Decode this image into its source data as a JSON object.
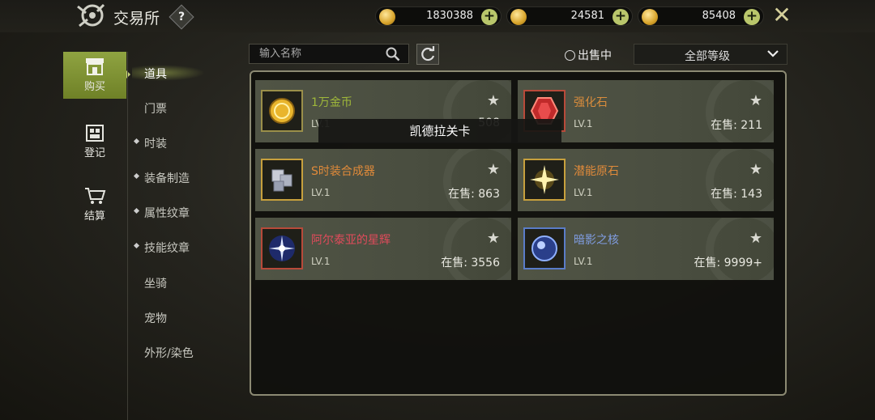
{
  "header": {
    "title": "交易所",
    "help": "?",
    "currencies": [
      {
        "name": "refresh-coin-icon",
        "value": "1830388",
        "color": "#d7a32a"
      },
      {
        "name": "gold-pile-icon",
        "value": "24581",
        "color": "#e2b33b"
      },
      {
        "name": "gold-coin-icon",
        "value": "85408",
        "color": "#e8b626"
      }
    ],
    "plus": "+",
    "close": "✕"
  },
  "leftnav": {
    "items": [
      {
        "label": "购买",
        "icon": "shop-icon",
        "active": true
      },
      {
        "label": "登记",
        "icon": "register-icon",
        "active": false
      },
      {
        "label": "结算",
        "icon": "cart-icon",
        "active": false
      }
    ]
  },
  "subnav": {
    "items": [
      {
        "label": "道具",
        "dot": false,
        "active": true
      },
      {
        "label": "门票",
        "dot": false
      },
      {
        "label": "时装",
        "dot": true
      },
      {
        "label": "装备制造",
        "dot": true
      },
      {
        "label": "属性纹章",
        "dot": true
      },
      {
        "label": "技能纹章",
        "dot": true
      },
      {
        "label": "坐骑",
        "dot": false
      },
      {
        "label": "宠物",
        "dot": false
      },
      {
        "label": "外形/染色",
        "dot": false
      }
    ]
  },
  "search": {
    "placeholder": "输入名称"
  },
  "filter": {
    "on_sale_label": "出售中",
    "grade_value": "全部等级"
  },
  "items": [
    {
      "name": "1万金币",
      "level": "LV.1",
      "count": "508",
      "name_color": "#9fb83a",
      "icon": "gold-coin-icon"
    },
    {
      "name": "强化石",
      "level": "LV.1",
      "count": "在售: 211",
      "name_color": "#d98c3c",
      "icon": "red-gem-icon"
    },
    {
      "name": "S时装合成器",
      "level": "LV.1",
      "count": "在售: 863",
      "name_color": "#e08a3a",
      "icon": "synthesizer-icon"
    },
    {
      "name": "潜能原石",
      "level": "LV.1",
      "count": "在售: 143",
      "name_color": "#e08a3a",
      "icon": "potential-stone-icon"
    },
    {
      "name": "阿尔泰亚的星辉",
      "level": "LV.1",
      "count": "在售: 3556",
      "name_color": "#e04b5b",
      "icon": "starlight-icon"
    },
    {
      "name": "暗影之核",
      "level": "LV.1",
      "count": "在售: 9999+",
      "name_color": "#7f9ce0",
      "icon": "shadow-core-icon"
    }
  ],
  "tooltip": "凯德拉关卡"
}
